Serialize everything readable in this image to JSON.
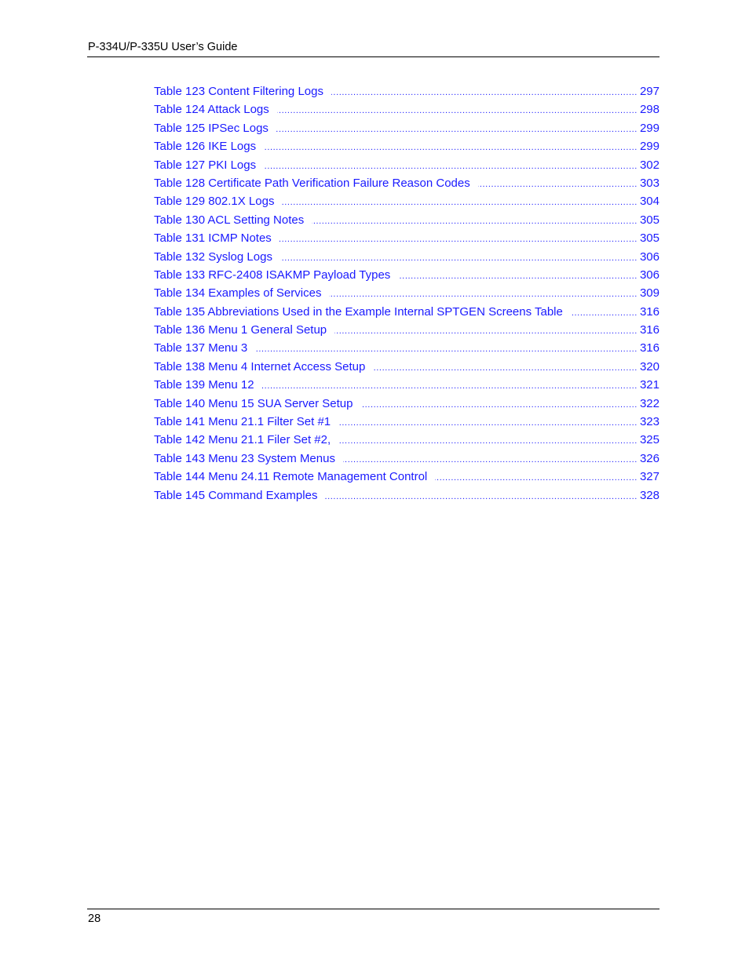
{
  "header": {
    "title": "P-334U/P-335U User’s Guide"
  },
  "colors": {
    "link": "#1a1aff",
    "text": "#000000",
    "rule": "#000000"
  },
  "toc": {
    "entries": [
      {
        "label": "Table 123 Content Filtering Logs",
        "page": "297"
      },
      {
        "label": "Table 124 Attack Logs",
        "page": "298"
      },
      {
        "label": "Table 125 IPSec Logs",
        "page": "299"
      },
      {
        "label": "Table 126 IKE Logs",
        "page": "299"
      },
      {
        "label": "Table 127 PKI Logs",
        "page": "302"
      },
      {
        "label": "Table 128 Certificate Path Verification Failure Reason Codes",
        "page": "303"
      },
      {
        "label": "Table 129 802.1X Logs",
        "page": "304"
      },
      {
        "label": "Table 130 ACL Setting Notes",
        "page": "305"
      },
      {
        "label": "Table 131 ICMP Notes",
        "page": "305"
      },
      {
        "label": "Table 132 Syslog Logs",
        "page": "306"
      },
      {
        "label": "Table 133 RFC-2408 ISAKMP Payload Types",
        "page": "306"
      },
      {
        "label": "Table 134 Examples of Services",
        "page": "309"
      },
      {
        "label": "Table 135 Abbreviations Used in the Example Internal SPTGEN Screens Table",
        "page": "316"
      },
      {
        "label": "Table 136 Menu 1 General Setup",
        "page": "316"
      },
      {
        "label": "Table 137 Menu 3",
        "page": "316"
      },
      {
        "label": "Table 138 Menu 4 Internet Access Setup",
        "page": "320"
      },
      {
        "label": "Table 139 Menu 12",
        "page": "321"
      },
      {
        "label": "Table 140 Menu 15 SUA Server Setup",
        "page": "322"
      },
      {
        "label": "Table 141 Menu 21.1 Filter Set #1",
        "page": "323"
      },
      {
        "label": "Table 142 Menu 21.1 Filer Set #2,",
        "page": "325"
      },
      {
        "label": "Table 143 Menu 23 System Menus",
        "page": "326"
      },
      {
        "label": "Table 144 Menu 24.11 Remote Management Control",
        "page": "327"
      },
      {
        "label": "Table 145 Command Examples",
        "page": "328"
      }
    ]
  },
  "footer": {
    "page_number": "28"
  }
}
